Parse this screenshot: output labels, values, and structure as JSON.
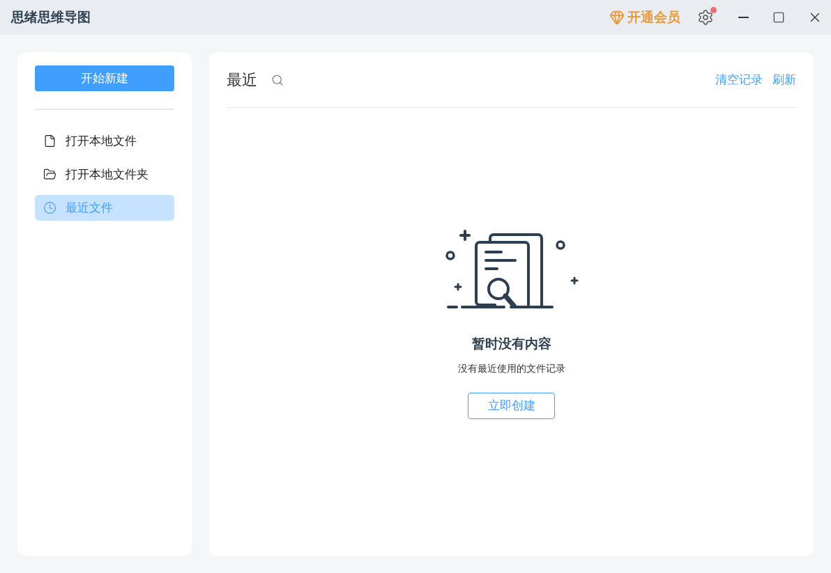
{
  "window": {
    "title": "思绪思维导图",
    "vip_label": "开通会员",
    "settings_badge": true
  },
  "sidebar": {
    "new_button": "开始新建",
    "items": [
      {
        "kind": "file",
        "label": "打开本地文件",
        "selected": false
      },
      {
        "kind": "folder",
        "label": "打开本地文件夹",
        "selected": false
      },
      {
        "kind": "clock",
        "label": "最近文件",
        "selected": true
      }
    ]
  },
  "main": {
    "title": "最近",
    "actions": [
      "清空记录",
      "刷新"
    ],
    "empty": {
      "title": "暂时没有内容",
      "subtitle": "没有最近使用的文件记录",
      "button": "立即创建"
    }
  }
}
